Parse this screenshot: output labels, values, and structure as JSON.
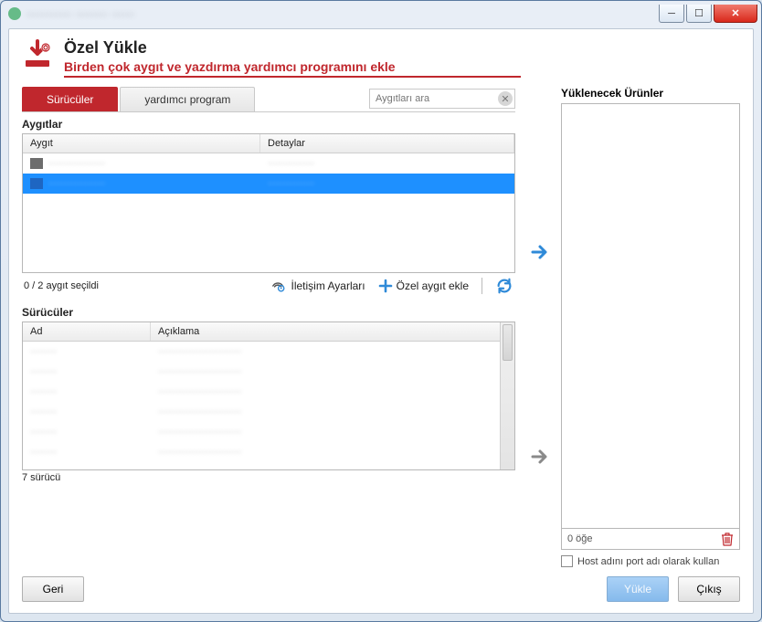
{
  "window": {
    "title": "·········· ······· ·····"
  },
  "header": {
    "title": "Özel Yükle",
    "subtitle": "Birden çok aygıt ve yazdırma yardımcı programını ekle"
  },
  "tabs": {
    "drivers": "Sürücüler",
    "utility": "yardımcı program"
  },
  "devices": {
    "title": "Aygıtlar",
    "search_placeholder": "Aygıtları ara",
    "col_device": "Aygıt",
    "col_details": "Detaylar",
    "rows": [
      {
        "name": "·················",
        "details": "··············",
        "selected": false
      },
      {
        "name": "·················",
        "details": "··············",
        "selected": true
      }
    ],
    "selected_text": "0 / 2 aygıt seçildi",
    "comm_settings": "İletişim Ayarları",
    "add_custom": "Özel aygıt ekle"
  },
  "drivers": {
    "title": "Sürücüler",
    "col_name": "Ad",
    "col_desc": "Açıklama",
    "count_text": "7 sürücü"
  },
  "products": {
    "title": "Yüklenecek Ürünler",
    "count_text": "0 öğe",
    "use_hostname": "Host adını port adı olarak kullan"
  },
  "footer": {
    "back": "Geri",
    "install": "Yükle",
    "exit": "Çıkış"
  }
}
